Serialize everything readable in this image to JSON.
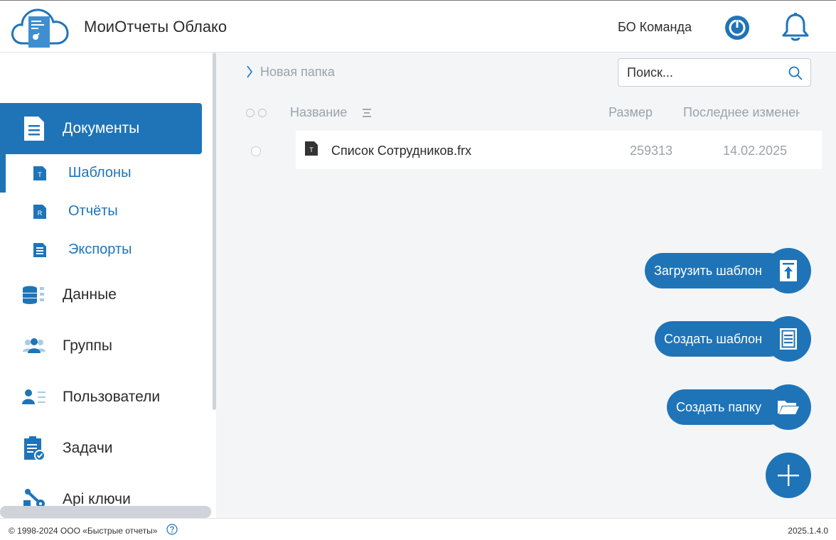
{
  "header": {
    "app_title": "МоиОтчеты Облако",
    "team_name": "БО Команда",
    "logo_icon": "cloud-report-logo",
    "power_icon": "power-icon",
    "bell_icon": "bell-icon"
  },
  "sidebar": {
    "items": [
      {
        "label": "Документы",
        "icon": "document-icon",
        "active": true
      },
      {
        "label": "Данные",
        "icon": "database-icon"
      },
      {
        "label": "Группы",
        "icon": "group-icon"
      },
      {
        "label": "Пользователи",
        "icon": "user-list-icon"
      },
      {
        "label": "Задачи",
        "icon": "clipboard-check-icon"
      },
      {
        "label": "Api ключи",
        "icon": "key-icon"
      }
    ],
    "subitems": [
      {
        "label": "Шаблоны",
        "icon": "template-file-icon",
        "badge": "T",
        "active": true
      },
      {
        "label": "Отчёты",
        "icon": "report-file-icon",
        "badge": "R"
      },
      {
        "label": "Экспорты",
        "icon": "export-file-icon"
      }
    ]
  },
  "main": {
    "breadcrumb": "Новая папка",
    "search_placeholder": "Поиск...",
    "columns": {
      "name": "Название",
      "size": "Размер",
      "modified": "Последнее изменен"
    },
    "files": [
      {
        "name": "Список Сотрудников.frx",
        "size": "259313",
        "modified": "14.02.2025",
        "badge": "T"
      }
    ]
  },
  "fabs": {
    "upload_template": "Загрузить шаблон",
    "create_template": "Создать шаблон",
    "create_folder": "Создать папку"
  },
  "footer": {
    "copyright": "© 1998-2024 ООО «Быстрые отчеты»",
    "version": "2025.1.4.0"
  },
  "colors": {
    "accent": "#1f74b8",
    "panel_bg": "#f4f5f6",
    "muted_text": "#9aa3ab"
  }
}
